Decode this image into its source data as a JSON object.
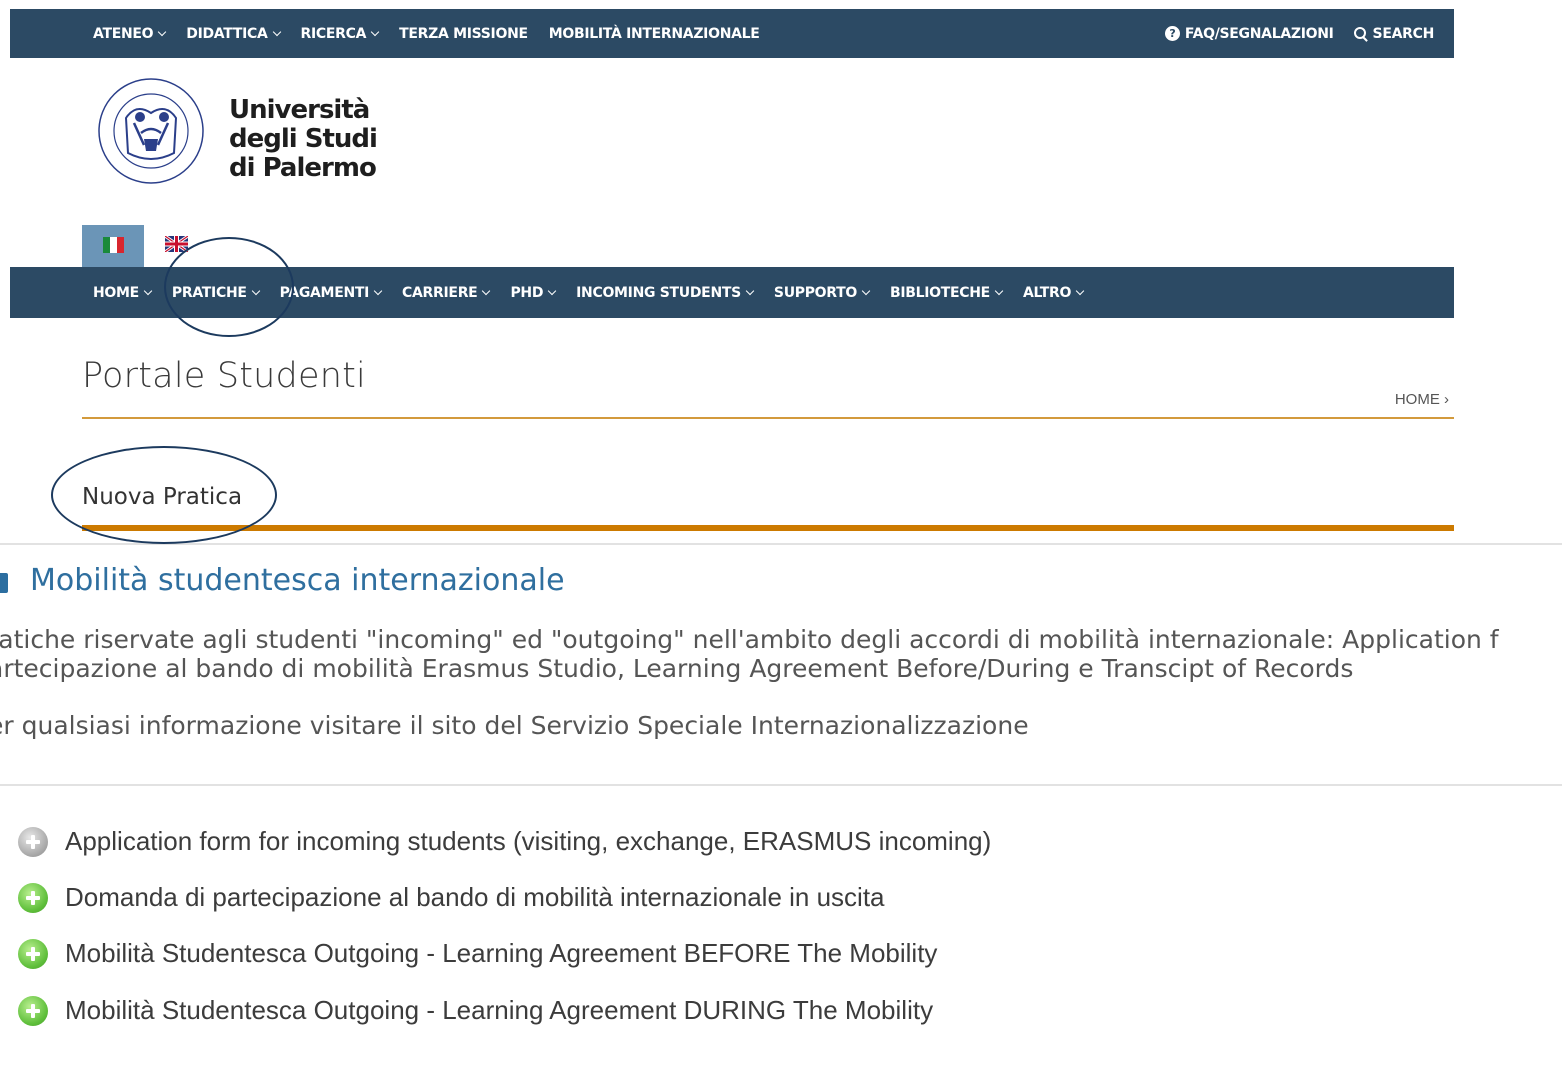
{
  "top_nav": {
    "items": [
      {
        "label": "ATENEO",
        "dropdown": true
      },
      {
        "label": "DIDATTICA",
        "dropdown": true
      },
      {
        "label": "RICERCA",
        "dropdown": true
      },
      {
        "label": "TERZA MISSIONE",
        "dropdown": false
      },
      {
        "label": "MOBILITÀ INTERNAZIONALE",
        "dropdown": false
      }
    ],
    "faq": "FAQ/SEGNALAZIONI",
    "search": "SEARCH"
  },
  "logo": {
    "line1": "Università",
    "line2": "degli Studi",
    "line3": "di Palermo"
  },
  "main_nav": {
    "items": [
      {
        "label": "HOME"
      },
      {
        "label": "PRATICHE"
      },
      {
        "label": "PAGAMENTI"
      },
      {
        "label": "CARRIERE"
      },
      {
        "label": "PHD"
      },
      {
        "label": "INCOMING STUDENTS"
      },
      {
        "label": "SUPPORTO"
      },
      {
        "label": "BIBLIOTECHE"
      },
      {
        "label": "ALTRO"
      }
    ]
  },
  "page": {
    "title": "Portale Studenti",
    "breadcrumb": "HOME ›",
    "section": "Nuova Pratica"
  },
  "category": {
    "title": "Mobilità studentesca internazionale",
    "desc_line1": "ratiche riservate agli studenti \"incoming\" ed \"outgoing\" nell'ambito degli accordi di mobilità internazionale: Application f",
    "desc_line2": "artecipazione al bando di mobilità Erasmus Studio, Learning Agreement Before/During e Transcipt of Records",
    "info": "er qualsiasi informazione visitare il sito del Servizio Speciale Internazionalizzazione"
  },
  "pratiche": [
    {
      "label": "Application form for incoming students (visiting, exchange, ERASMUS incoming)",
      "status": "disabled"
    },
    {
      "label": "Domanda di partecipazione al bando di mobilità internazionale in uscita",
      "status": "enabled"
    },
    {
      "label": "Mobilità Studentesca Outgoing - Learning Agreement BEFORE The Mobility",
      "status": "enabled"
    },
    {
      "label": "Mobilità Studentesca Outgoing - Learning Agreement DURING The Mobility",
      "status": "enabled"
    }
  ],
  "colors": {
    "nav_bg": "#2c4a64",
    "accent_orange": "#cc7a00",
    "category_blue": "#2f6f9f"
  }
}
